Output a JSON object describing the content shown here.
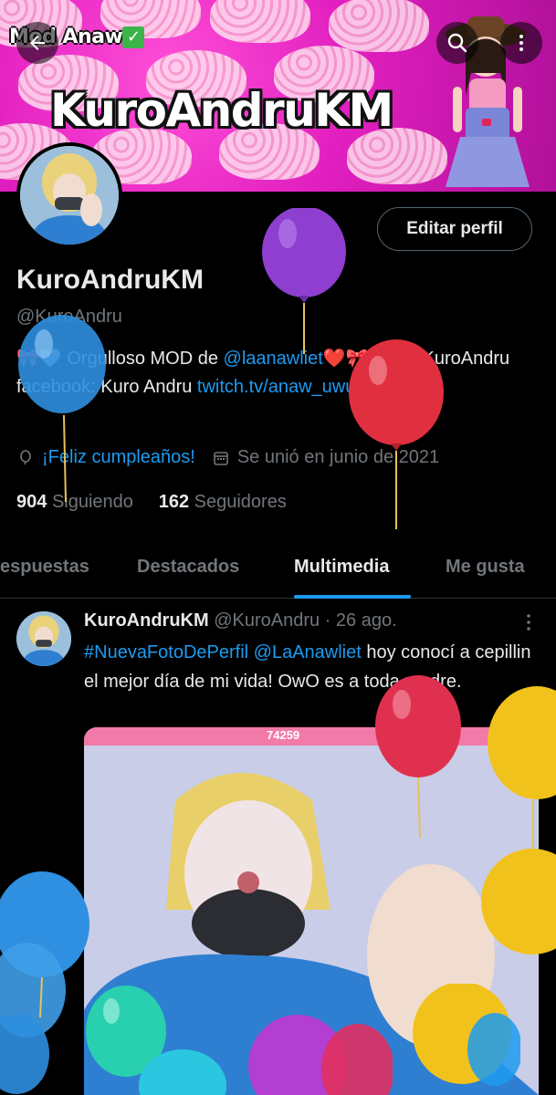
{
  "banner": {
    "mod_text": "Mod Anaw",
    "check_glyph": "✓",
    "title": "KuroAndruKM"
  },
  "header_icons": {
    "back": "back-arrow-icon",
    "search": "search-icon",
    "more": "more-vertical-icon"
  },
  "profile": {
    "display_name": "KuroAndruKM",
    "handle": "@KuroAndru",
    "edit_label": "Editar perfil",
    "bio": {
      "prefix_emoji": "🎀🤍",
      "text1": " Orgulloso MOD de ",
      "mention": "@laanawliet",
      "emoji2": "❤️🎀",
      "text2": " insta: KuroAndru facebook: Kuro Andru ",
      "link": "twitch.tv/anaw_uwu?sr=a"
    },
    "birthday": "¡Feliz cumpleaños!",
    "joined": "Se unió en junio de 2021",
    "following_count": "904",
    "following_label": "Siguiendo",
    "followers_count": "162",
    "followers_label": "Seguidores"
  },
  "tabs": [
    {
      "label": "espuestas"
    },
    {
      "label": "Destacados"
    },
    {
      "label": "Multimedia"
    },
    {
      "label": "Me gusta"
    }
  ],
  "post": {
    "name": "KuroAndruKM",
    "handle_date": "@KuroAndru · 26 ago.",
    "hashtag": "#NuevaFotoDePerfil",
    "mention": "@LaAnawliet",
    "text": " hoy conocí a cepillin el mejor día de mi vida! OwO es a toda madre.",
    "counter": "74259"
  },
  "colors": {
    "accent": "#1d9bf0",
    "background": "#000000",
    "text": "#e7e9ea",
    "muted": "#71767b",
    "banner_pink": "#e21fc0"
  }
}
